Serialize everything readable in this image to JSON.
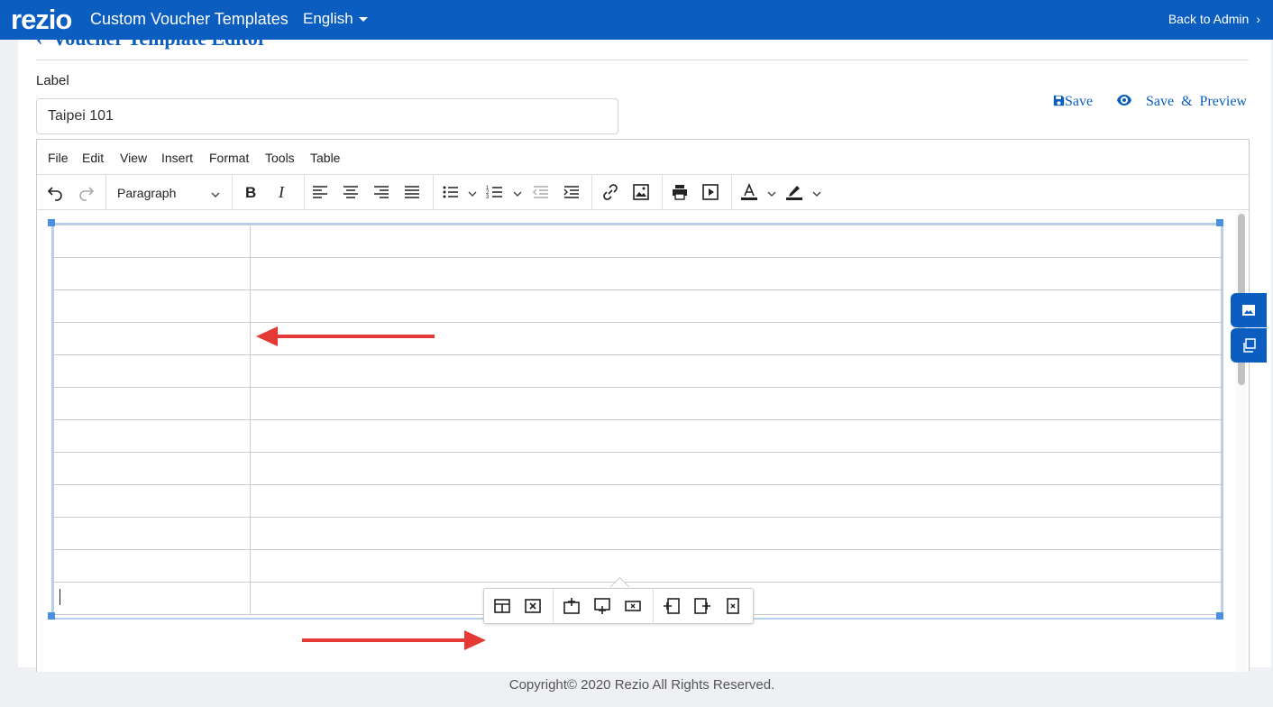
{
  "header": {
    "logo": "rezio",
    "title": "Custom Voucher Templates",
    "language": "English",
    "back_link": "Back to Admin",
    "bg_color": "#0b5ec0"
  },
  "page": {
    "heading": "Voucher Template Editor",
    "label": "Label",
    "label_value": "Taipei 101",
    "save_label": "Save",
    "preview_label": "Save & Preview"
  },
  "editor": {
    "menu": [
      "File",
      "Edit",
      "View",
      "Insert",
      "Format",
      "Tools",
      "Table"
    ],
    "block_format": "Paragraph",
    "toolbar_icons": [
      "undo-icon",
      "redo-icon",
      "bold-icon",
      "italic-icon",
      "align-left-icon",
      "align-center-icon",
      "align-right-icon",
      "justify-icon",
      "bullet-list-icon",
      "numbered-list-icon",
      "outdent-icon",
      "indent-icon",
      "link-icon",
      "image-icon",
      "print-icon",
      "media-icon",
      "text-color-icon",
      "highlight-icon"
    ],
    "table_rows": 12,
    "table_cols": 2,
    "table_toolbar_icons": [
      "table-properties-icon",
      "delete-table-icon",
      "insert-row-before-icon",
      "insert-row-after-icon",
      "delete-row-icon",
      "insert-col-before-icon",
      "insert-col-after-icon",
      "delete-col-icon"
    ]
  },
  "side_tabs": [
    "image-panel-icon",
    "copy-panel-icon"
  ],
  "annotation_color": "#e53935",
  "footer": "Copyright© 2020 Rezio All Rights Reserved."
}
